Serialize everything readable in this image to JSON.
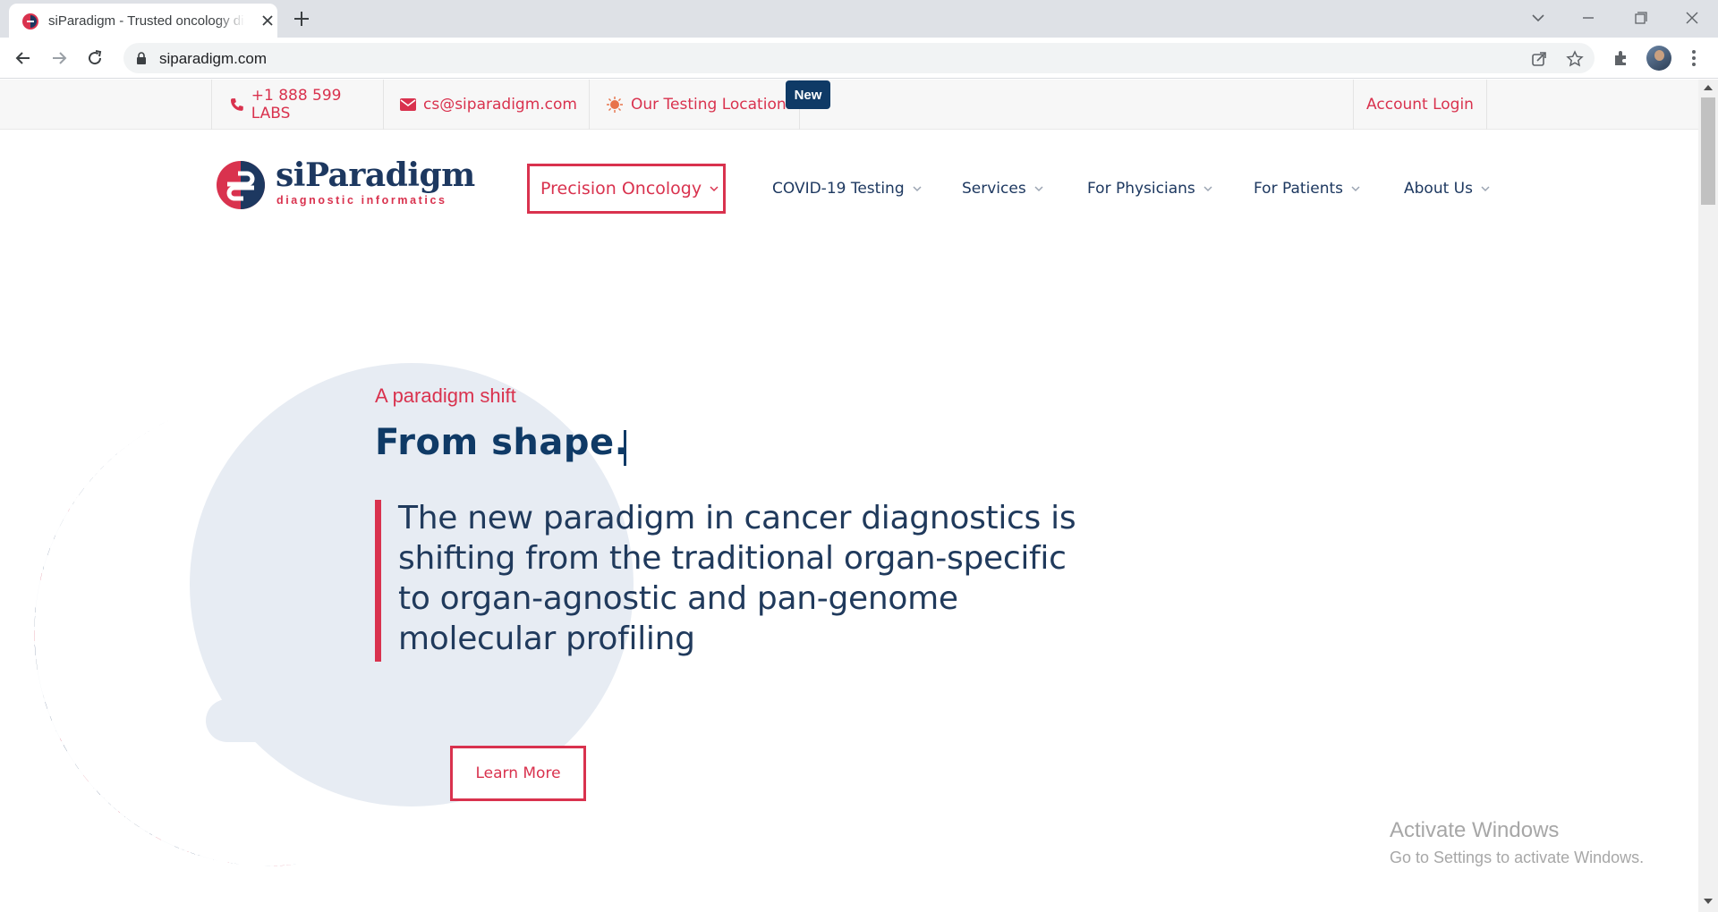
{
  "browser": {
    "tab_title": "siParadigm - Trusted oncology diagnostics",
    "url": "siparadigm.com"
  },
  "topbar": {
    "phone": "+1 888 599 LABS",
    "email": "cs@siparadigm.com",
    "locations": "Our Testing Locations",
    "new_badge": "New",
    "account_login": "Account Login"
  },
  "logo": {
    "name": "siParadigm",
    "tagline": "diagnostic informatics"
  },
  "nav": {
    "items": [
      {
        "label": "Precision Oncology"
      },
      {
        "label": "COVID-19 Testing"
      },
      {
        "label": "Services"
      },
      {
        "label": "For Physicians"
      },
      {
        "label": "For Patients"
      },
      {
        "label": "About Us"
      }
    ]
  },
  "hero": {
    "eyebrow": "A paradigm shift",
    "headline": "From shape.",
    "body": "The new paradigm in cancer diagnostics is shifting from the traditional organ-specific to organ-agnostic and pan-genome molecular profiling",
    "cta": "Learn More"
  },
  "watermark": {
    "title": "Activate Windows",
    "subtitle": "Go to Settings to activate Windows."
  },
  "colors": {
    "brand_red": "#d9324e",
    "brand_navy": "#0f3a66"
  },
  "icons": [
    "phone-icon",
    "mail-icon",
    "virus-icon",
    "chevron-down-icon",
    "lock-icon",
    "star-icon",
    "share-icon",
    "extensions-icon",
    "menu-icon"
  ]
}
